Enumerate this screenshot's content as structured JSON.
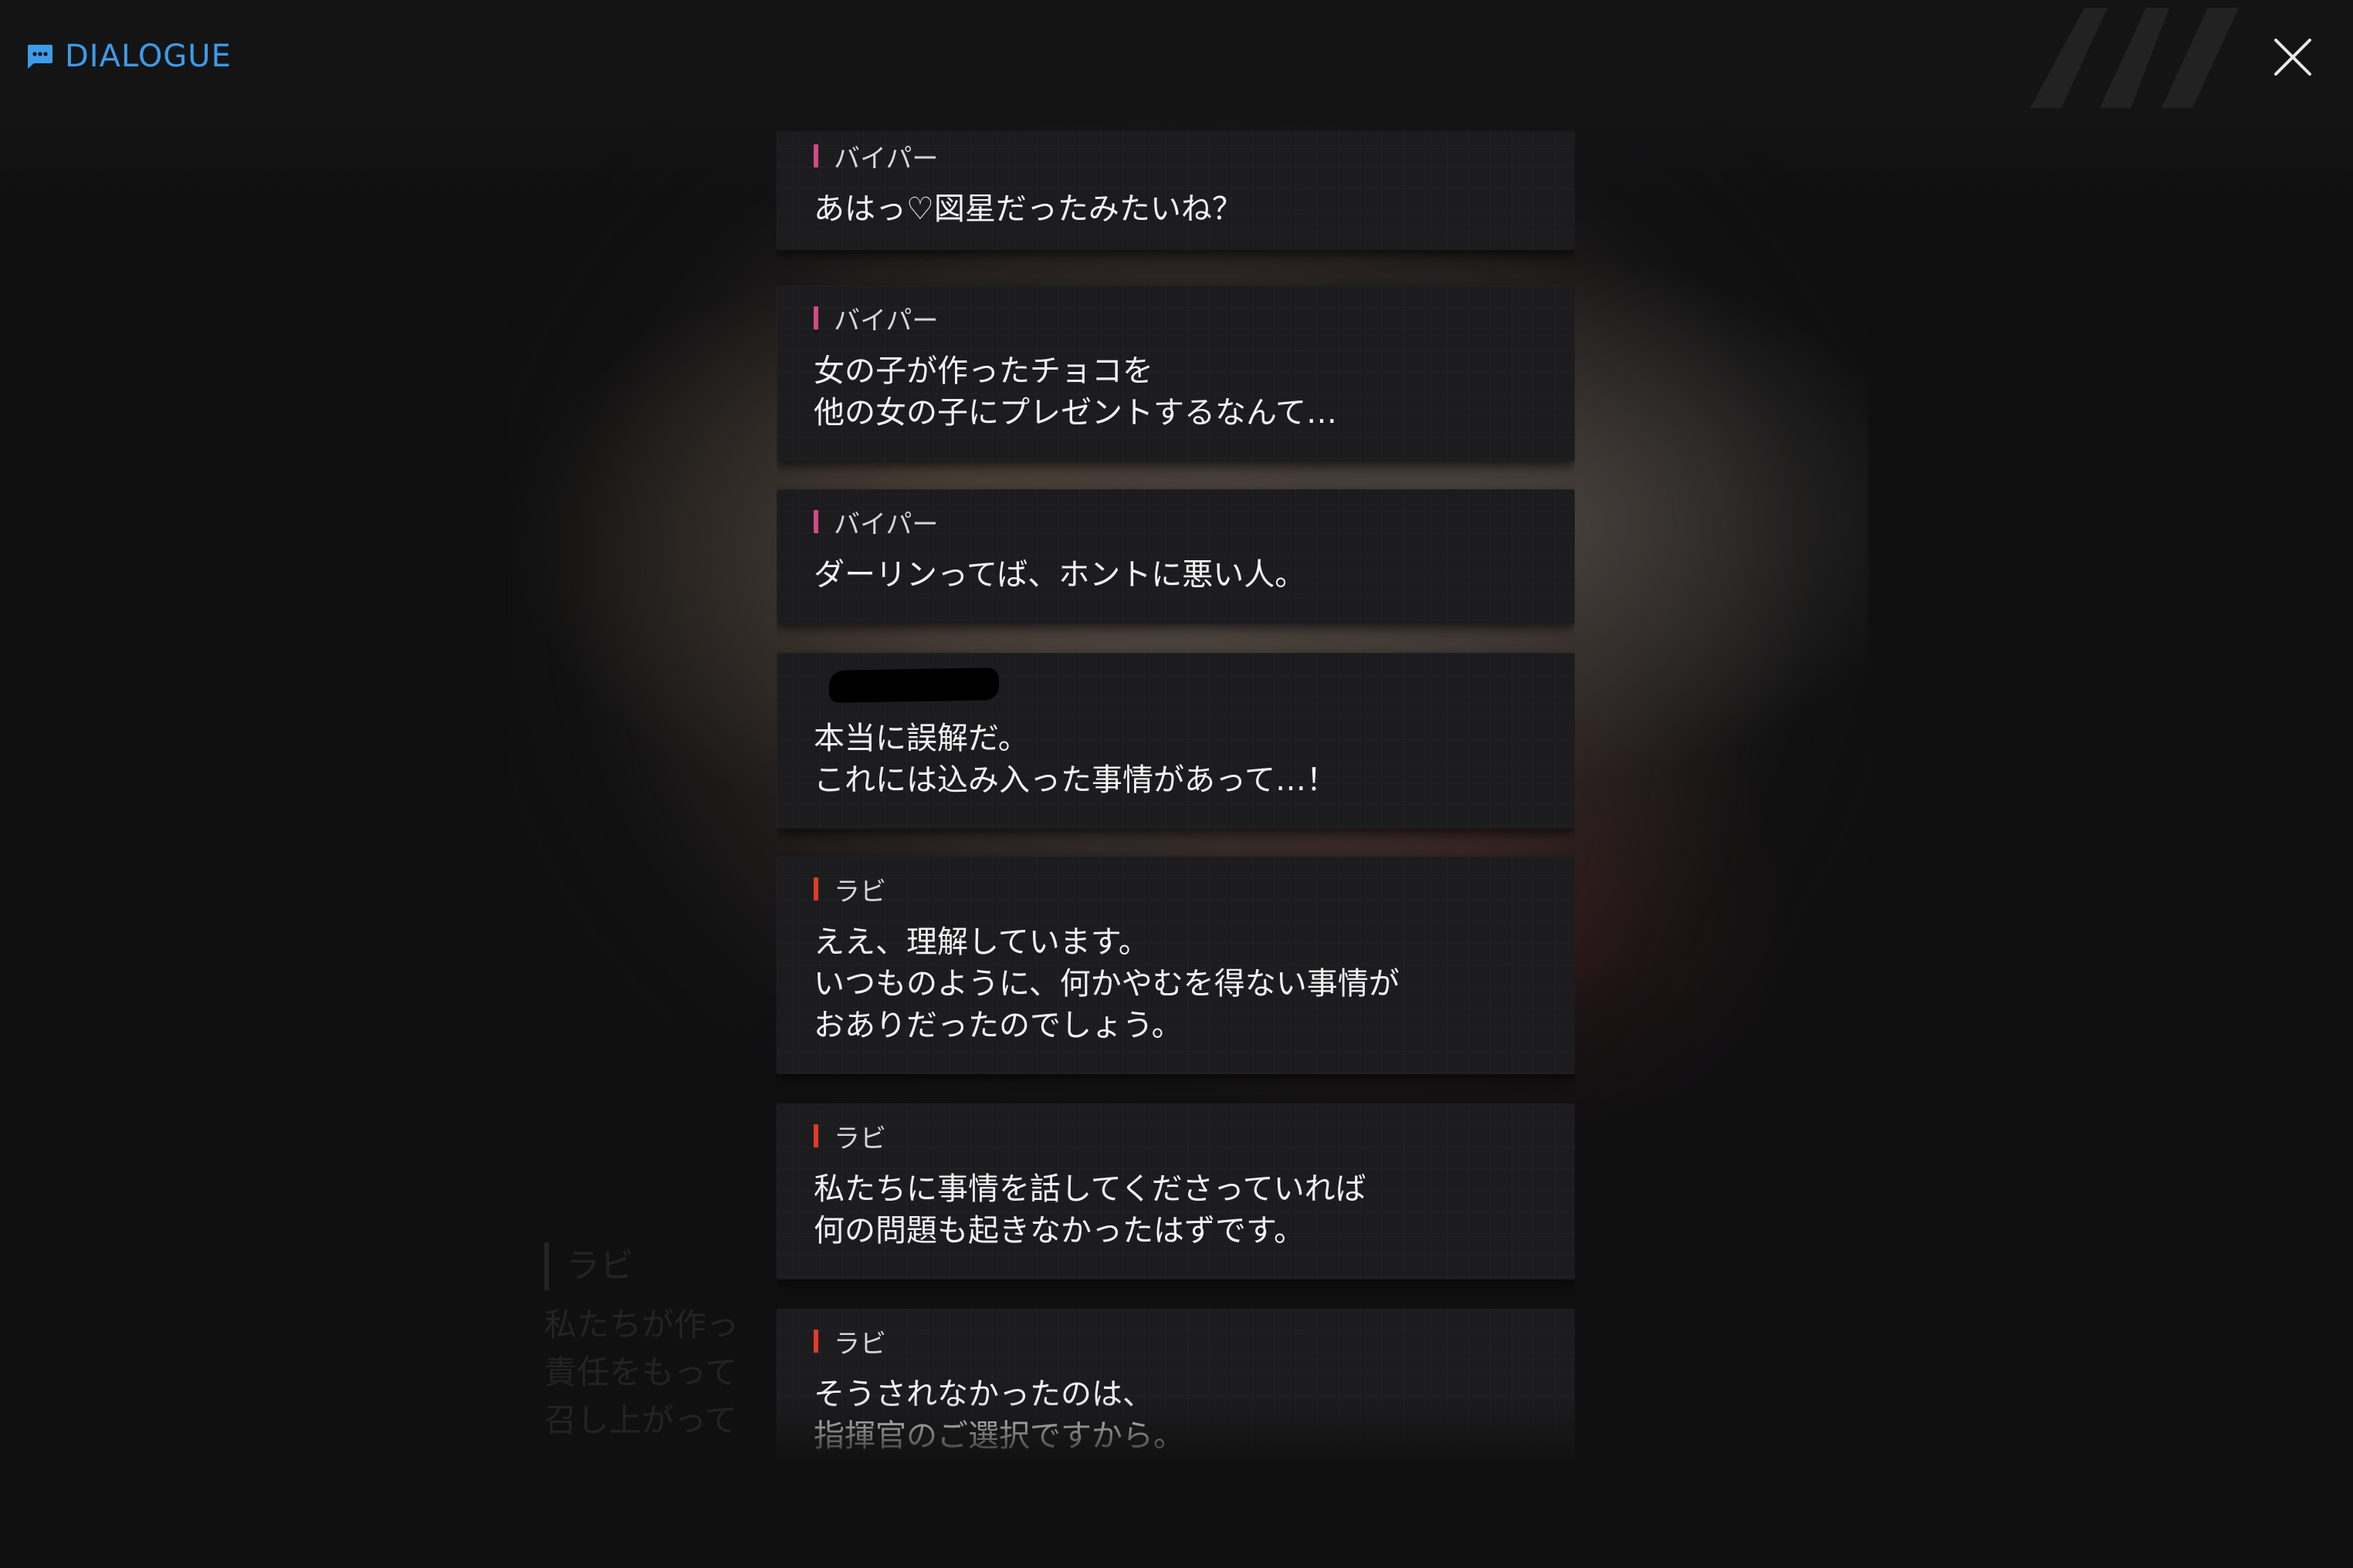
{
  "header": {
    "title": "DIALOGUE",
    "accent_color": "#3d9be9",
    "icon": "chat-bubble-icon"
  },
  "close_button": {
    "icon": "close-icon"
  },
  "ghost_text": {
    "name": "ラビ",
    "lines": [
      "私たちが作っ",
      "責任をもって",
      "召し上がって"
    ]
  },
  "speaker_colors": {
    "viper": "#d04a8a",
    "rapi": "#e23a2a"
  },
  "dialogue": [
    {
      "speaker": "バイパー",
      "speaker_color": "#d04a8a",
      "text": "あはっ♡図星だったみたいね？"
    },
    {
      "speaker": "バイパー",
      "speaker_color": "#d04a8a",
      "text": "女の子が作ったチョコを\n他の女の子にプレゼントするなんて…"
    },
    {
      "speaker": "バイパー",
      "speaker_color": "#d04a8a",
      "text": "ダーリンってば、ホントに悪い人。"
    },
    {
      "speaker": "",
      "speaker_color": "#000000",
      "text": "本当に誤解だ。\nこれには込み入った事情があって…！"
    },
    {
      "speaker": "ラビ",
      "speaker_color": "#e23a2a",
      "text": "ええ、理解しています。\nいつものように、何かやむを得ない事情が\nおありだったのでしょう。"
    },
    {
      "speaker": "ラビ",
      "speaker_color": "#e23a2a",
      "text": "私たちに事情を話してくださっていれば\n何の問題も起きなかったはずです。"
    },
    {
      "speaker": "ラビ",
      "speaker_color": "#e23a2a",
      "text": "そうされなかったのは、\n指揮官のご選択ですから。"
    }
  ]
}
